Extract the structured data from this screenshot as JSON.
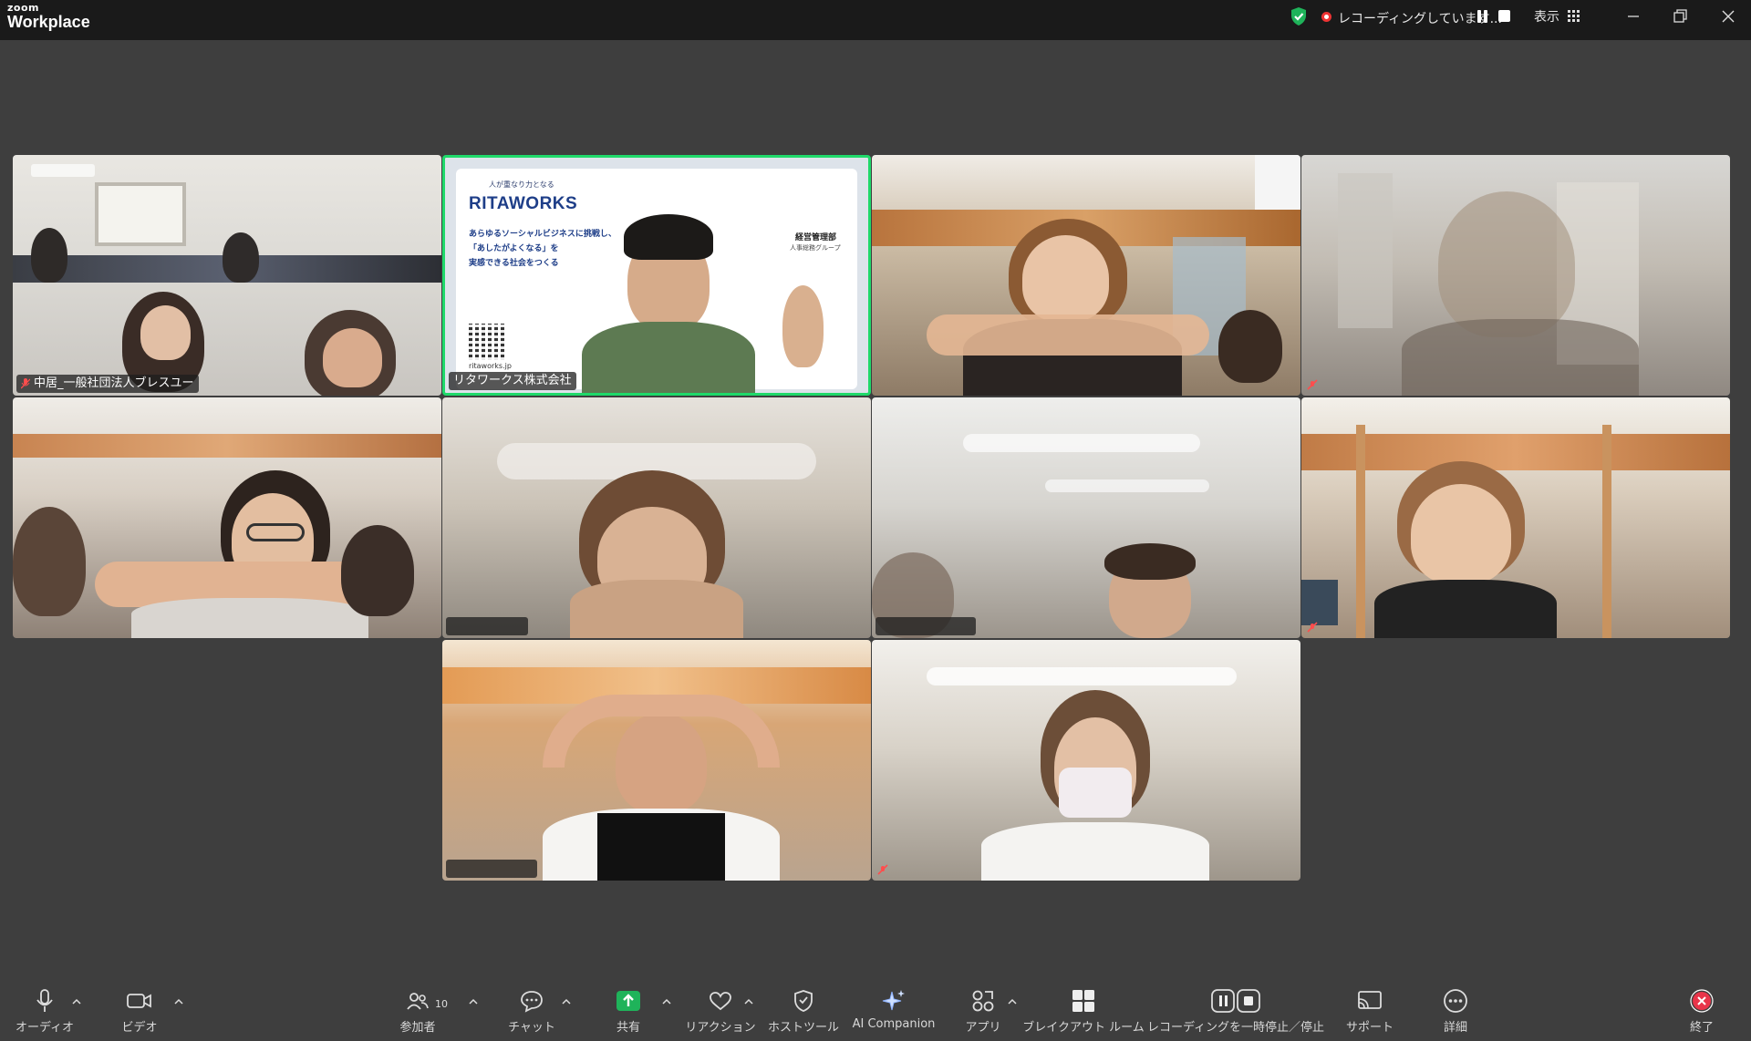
{
  "app": {
    "logo_small": "zoom",
    "logo_big": "Workplace"
  },
  "titlebar": {
    "recording_text": "レコーディングしています...",
    "view_label": "表示"
  },
  "tiles": [
    {
      "name": "中居_一般社団法人ブレスユー",
      "mic_muted": true,
      "active": false
    },
    {
      "name": "リタワークス株式会社",
      "mic_muted": false,
      "active": true
    },
    {
      "name": "",
      "mic_muted": false,
      "active": false
    },
    {
      "name": "",
      "mic_muted": true,
      "active": false
    },
    {
      "name": "",
      "mic_muted": false,
      "active": false
    },
    {
      "name": "",
      "mic_muted": false,
      "active": false
    },
    {
      "name": "",
      "mic_muted": false,
      "active": false
    },
    {
      "name": "",
      "mic_muted": true,
      "active": false
    },
    {
      "name": "",
      "mic_muted": false,
      "active": false
    },
    {
      "name": "",
      "mic_muted": true,
      "active": false
    }
  ],
  "slide": {
    "tagline": "人が重なり力となる",
    "brand": "RITAWORKS",
    "line1": "あらゆるソーシャルビジネスに挑戦し、",
    "line2": "「あしたがよくなる」を",
    "line3": "実感できる社会をつくる",
    "dept": "経営管理部",
    "group": "人事総務グループ",
    "url": "ritaworks.jp"
  },
  "toolbar": {
    "audio": "オーディオ",
    "video": "ビデオ",
    "participants": "参加者",
    "participant_count": "10",
    "chat": "チャット",
    "share": "共有",
    "reactions": "リアクション",
    "host_tools": "ホストツール",
    "ai_companion": "AI Companion",
    "apps": "アプリ",
    "breakout": "ブレイクアウト ルーム",
    "recording_control": "レコーディングを一時停止／停止",
    "support": "サポート",
    "more": "詳細",
    "end": "終了"
  },
  "colors": {
    "active_speaker": "#1fd96a",
    "share_green": "#1fb35a",
    "end_red": "#e8344a",
    "background": "#3e3e3e"
  }
}
